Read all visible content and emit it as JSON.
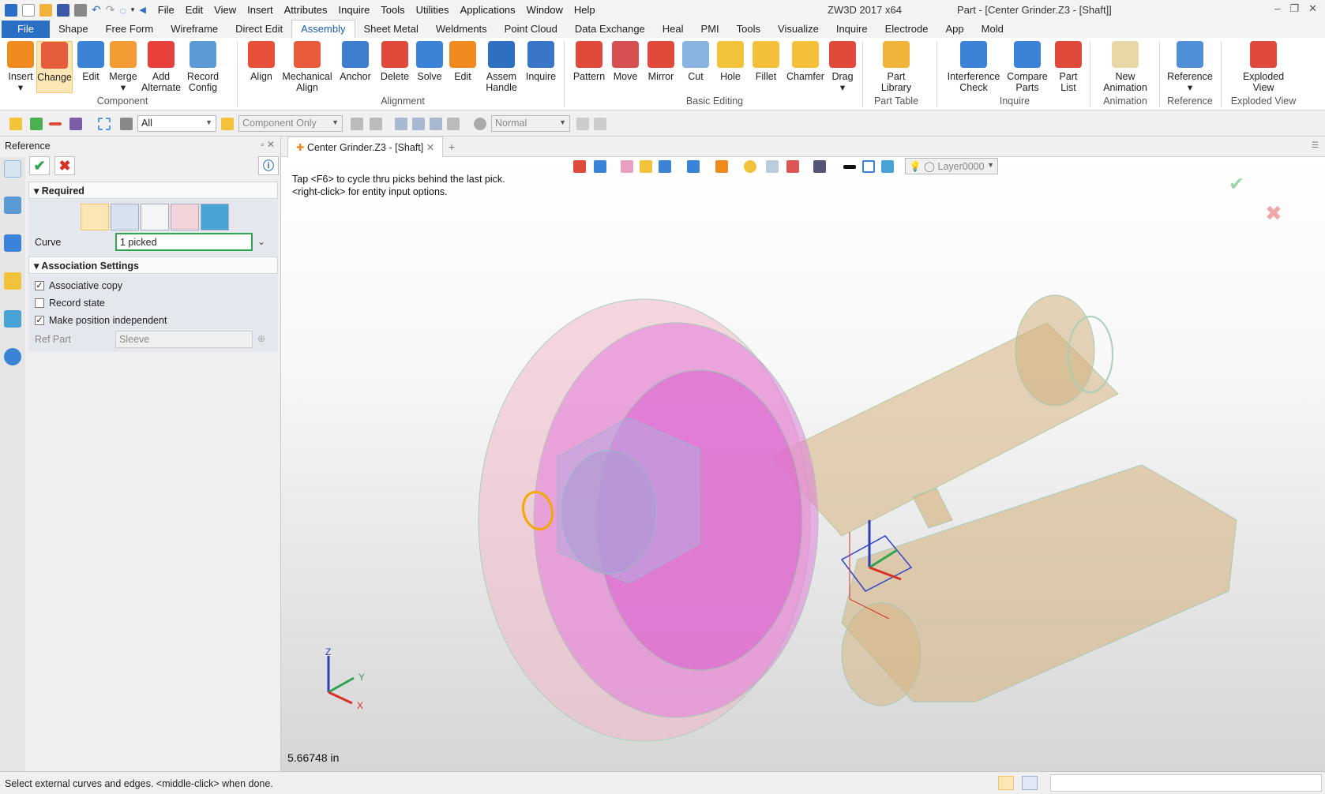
{
  "app": {
    "title": "ZW3D 2017  x64",
    "doc_title": "Part - [Center Grinder.Z3 - [Shaft]]"
  },
  "menu": [
    "File",
    "Edit",
    "View",
    "Insert",
    "Attributes",
    "Inquire",
    "Tools",
    "Utilities",
    "Applications",
    "Window",
    "Help"
  ],
  "ribbon_tabs": [
    "File",
    "Shape",
    "Free Form",
    "Wireframe",
    "Direct Edit",
    "Assembly",
    "Sheet Metal",
    "Weldments",
    "Point Cloud",
    "Data Exchange",
    "Heal",
    "PMI",
    "Tools",
    "Visualize",
    "Inquire",
    "Electrode",
    "App",
    "Mold"
  ],
  "active_tab": "Assembly",
  "ribbon": {
    "component": {
      "label": "Component",
      "buttons": [
        "Insert",
        "Change",
        "Edit",
        "Merge",
        "Add\nAlternate",
        "Record\nConfig"
      ]
    },
    "alignment": {
      "label": "Alignment",
      "buttons": [
        "Align",
        "Mechanical\nAlign",
        "Anchor",
        "Delete",
        "Solve",
        "Edit",
        "Assem\nHandle",
        "Inquire"
      ]
    },
    "basic_editing": {
      "label": "Basic Editing",
      "buttons": [
        "Pattern",
        "Move",
        "Mirror",
        "Cut",
        "Hole",
        "Fillet",
        "Chamfer",
        "Drag"
      ]
    },
    "part_table": {
      "label": "Part Table",
      "buttons": [
        "Part\nLibrary"
      ]
    },
    "inquire": {
      "label": "Inquire",
      "buttons": [
        "Interference\nCheck",
        "Compare\nParts",
        "Part\nList"
      ]
    },
    "animation": {
      "label": "Animation",
      "buttons": [
        "New\nAnimation"
      ]
    },
    "reference": {
      "label": "Reference",
      "buttons": [
        "Reference"
      ]
    },
    "exploded_view": {
      "label": "Exploded View",
      "buttons": [
        "Exploded\nView"
      ]
    }
  },
  "toolbar2": {
    "filter_value": "All",
    "component_filter": "Component Only",
    "render_mode": "Normal"
  },
  "panel": {
    "title": "Reference",
    "required_label": "Required",
    "curve_label": "Curve",
    "curve_value": "1 picked",
    "association_label": "Association Settings",
    "checkboxes": [
      {
        "label": "Associative copy",
        "checked": true
      },
      {
        "label": "Record state",
        "checked": false
      },
      {
        "label": "Make position independent",
        "checked": true
      }
    ],
    "ref_part_label": "Ref Part",
    "ref_part_value": "Sleeve"
  },
  "viewport": {
    "tab_label": "Center Grinder.Z3 - [Shaft]",
    "layer": "Layer0000",
    "hint_line1": "Tap <F6> to cycle thru picks behind the last pick.",
    "hint_line2": "<right-click> for entity input options.",
    "measure": "5.66748 in",
    "axis_labels": {
      "x": "X",
      "y": "Y",
      "z": "Z"
    }
  },
  "status": {
    "message": "Select external curves and edges.  <middle-click> when done."
  },
  "colors": {
    "file_tab": "#2b6fc4",
    "accent": "#1b5fb0",
    "pink_part": "#e27bd8",
    "tan_part": "#d9b98a",
    "selection": "#f3a800"
  }
}
